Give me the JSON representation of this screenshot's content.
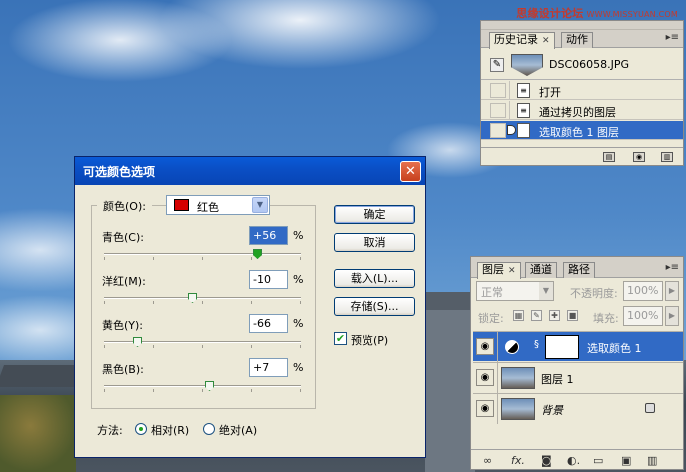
{
  "watermark": {
    "main": "思缘设计论坛",
    "sub": "WWW.MISSYUAN.COM"
  },
  "history_panel": {
    "tabs": [
      {
        "label": "历史记录"
      },
      {
        "label": "动作"
      }
    ],
    "snapshot": {
      "name": "DSC06058.JPG"
    },
    "states": [
      {
        "label": "打开"
      },
      {
        "label": "通过拷贝的图层"
      },
      {
        "label": "选取颜色 1 图层"
      }
    ],
    "footer_icons": [
      "new-document-icon",
      "snapshot-icon",
      "trash-icon"
    ]
  },
  "layers_panel": {
    "tabs": [
      {
        "label": "图层"
      },
      {
        "label": "通道"
      },
      {
        "label": "路径"
      }
    ],
    "blend_mode": "正常",
    "opacity_label": "不透明度:",
    "opacity_value": "100%",
    "lock_label": "锁定:",
    "fill_label": "填充:",
    "fill_value": "100%",
    "layers": [
      {
        "name": "选取颜色 1"
      },
      {
        "name": "图层 1"
      },
      {
        "name": "背景"
      }
    ]
  },
  "dialog": {
    "title": "可选颜色选项",
    "colors_label": "颜色(O):",
    "colors_value": "红色",
    "colors_swatch": "#d40000",
    "sliders": [
      {
        "label": "青色(C):",
        "value": "+56",
        "percent": 56
      },
      {
        "label": "洋红(M):",
        "value": "-10",
        "percent": -10
      },
      {
        "label": "黄色(Y):",
        "value": "-66",
        "percent": -66
      },
      {
        "label": "黑色(B):",
        "value": "+7",
        "percent": 7
      }
    ],
    "percent_sign": "%",
    "buttons": {
      "ok": "确定",
      "cancel": "取消",
      "load": "载入(L)...",
      "save": "存储(S)..."
    },
    "preview_label": "预览(P)",
    "preview_checked": true,
    "method_label": "方法:",
    "method_options": [
      {
        "label": "相对(R)",
        "selected": true
      },
      {
        "label": "绝对(A)",
        "selected": false
      }
    ]
  }
}
